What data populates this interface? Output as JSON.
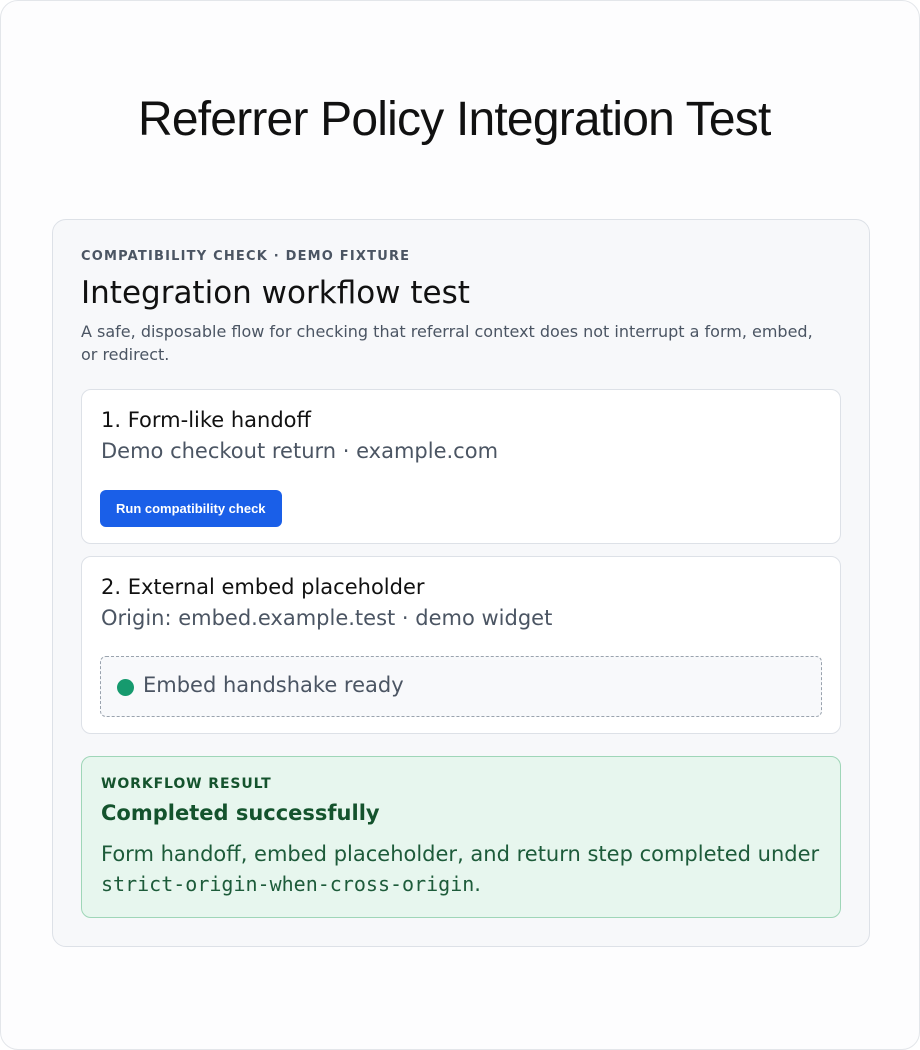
{
  "page": {
    "title": "Referrer Policy Integration Test"
  },
  "panel": {
    "eyebrow": "COMPATIBILITY CHECK · DEMO FIXTURE",
    "title": "Integration workflow test",
    "description": "A safe, disposable flow for checking that referral context does not interrupt a form, embed, or redirect."
  },
  "steps": [
    {
      "title": "1. Form-like handoff",
      "meta": "Demo checkout return · example.com",
      "button_label": "Run compatibility check"
    },
    {
      "title": "2. External embed placeholder",
      "meta": "Origin: embed.example.test · demo widget",
      "status_text": "Embed handshake ready",
      "status_color": "#169a6e"
    }
  ],
  "result": {
    "label": "WORKFLOW RESULT",
    "title": "Completed successfully",
    "description_prefix": "Form handoff, embed placeholder, and return step completed under ",
    "policy": "strict-origin-when-cross-origin",
    "description_suffix": "."
  },
  "colors": {
    "accent": "#1a5fe8",
    "success_bg": "#e7f6ee",
    "success_text": "#14532d"
  }
}
